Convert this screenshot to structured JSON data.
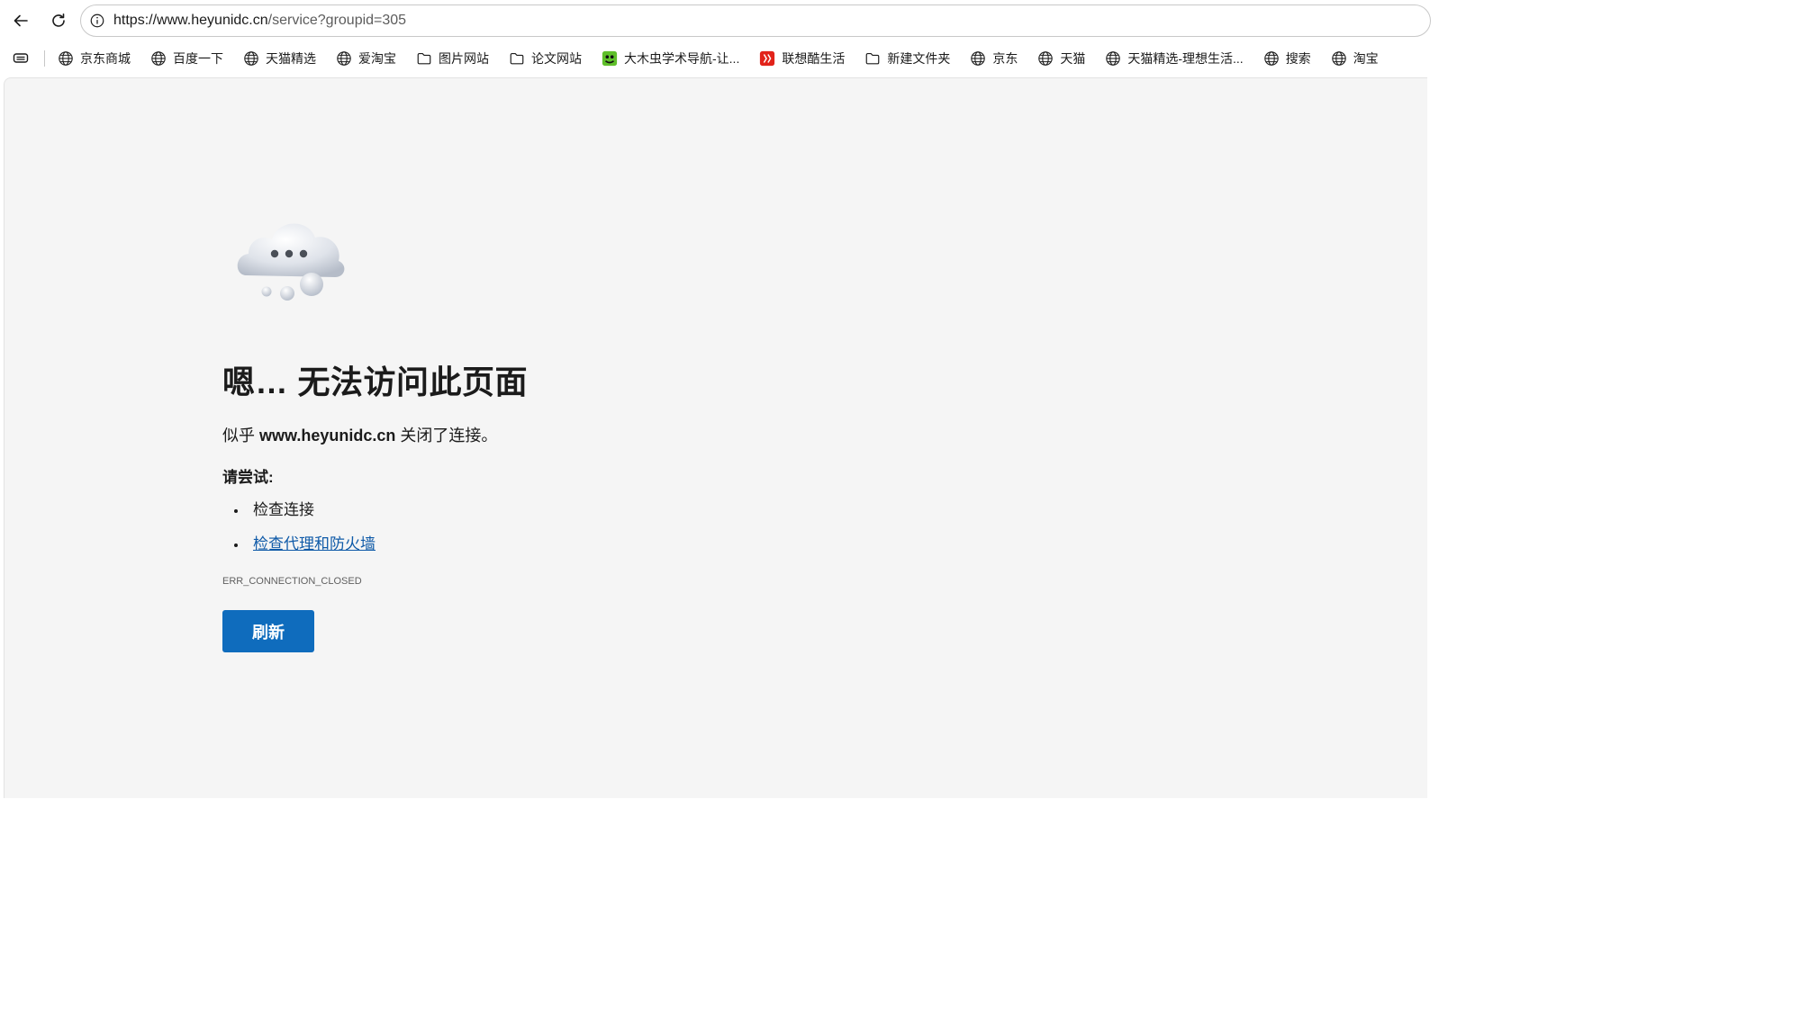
{
  "toolbar": {
    "url_host": "https://www.heyunidc.cn",
    "url_rest": "/service?groupid=305"
  },
  "bookmarks": [
    {
      "label": "京东商城",
      "icon": "globe-icon"
    },
    {
      "label": "百度一下",
      "icon": "globe-icon"
    },
    {
      "label": "天猫精选",
      "icon": "globe-icon"
    },
    {
      "label": "爱淘宝",
      "icon": "globe-icon"
    },
    {
      "label": "图片网站",
      "icon": "folder-icon"
    },
    {
      "label": "论文网站",
      "icon": "folder-icon"
    },
    {
      "label": "大木虫学术导航-让...",
      "icon": "damuchong-icon"
    },
    {
      "label": "联想酷生活",
      "icon": "lenovo-icon"
    },
    {
      "label": "新建文件夹",
      "icon": "folder-icon"
    },
    {
      "label": "京东",
      "icon": "globe-icon"
    },
    {
      "label": "天猫",
      "icon": "globe-icon"
    },
    {
      "label": "天猫精选-理想生活...",
      "icon": "globe-icon"
    },
    {
      "label": "搜索",
      "icon": "globe-icon"
    },
    {
      "label": "淘宝",
      "icon": "globe-icon"
    }
  ],
  "error": {
    "title": "嗯… 无法访问此页面",
    "desc_prefix": "似乎 ",
    "desc_host": "www.heyunidc.cn",
    "desc_suffix": " 关闭了连接。",
    "try_label": "请尝试:",
    "suggestion_1": "检查连接",
    "suggestion_2": "检查代理和防火墙",
    "code": "ERR_CONNECTION_CLOSED",
    "refresh_label": "刷新"
  },
  "colors": {
    "accent": "#0f6cbd",
    "link": "#0f5aa8",
    "content_bg": "#f5f5f5"
  }
}
